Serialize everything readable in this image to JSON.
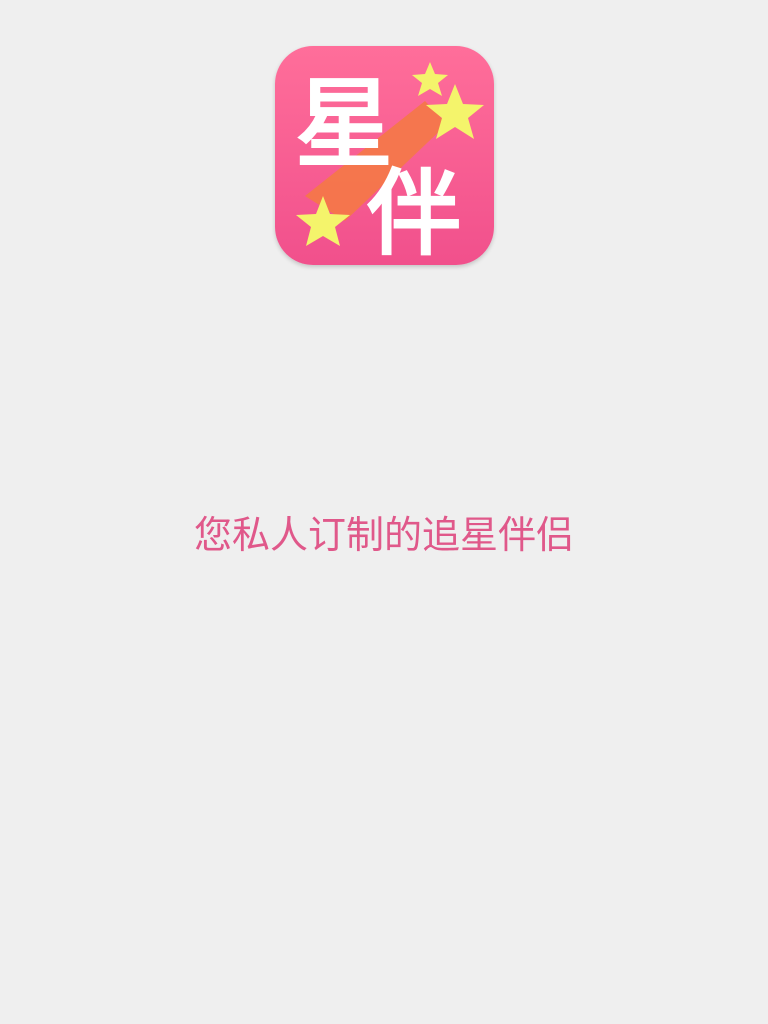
{
  "app": {
    "logo_text": "星伴",
    "logo_char_1": "星",
    "logo_char_2": "伴",
    "slogan": "您私人订制的追星伴侣"
  },
  "colors": {
    "background": "#efefef",
    "icon_gradient_top": "#ff6e9a",
    "icon_gradient_bottom": "#f1508c",
    "star": "#f4f46b",
    "streak": "#f4774a",
    "slogan": "#e0588a"
  },
  "icons": {
    "app_icon": "app-logo-icon",
    "stars": "star-icon"
  }
}
